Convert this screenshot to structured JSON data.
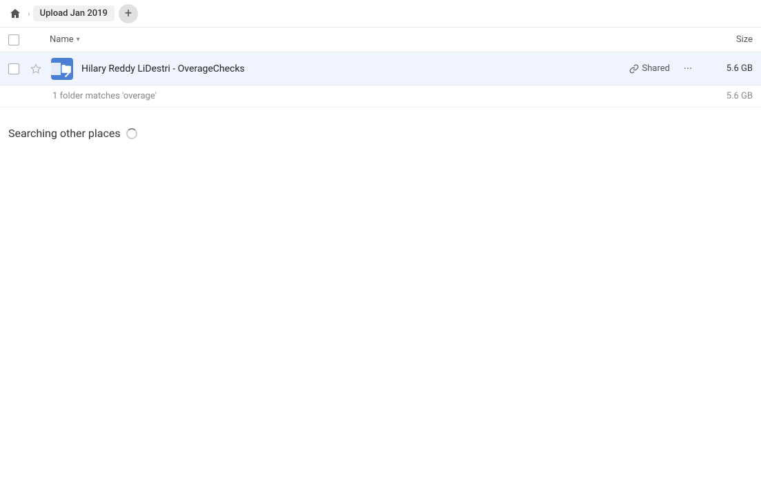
{
  "breadcrumb": {
    "home_label": "Home",
    "title": "Upload Jan 2019",
    "add_label": "+"
  },
  "columns": {
    "name_label": "Name",
    "size_label": "Size"
  },
  "file_row": {
    "name": "Hilary Reddy LiDestri - OverageChecks",
    "shared_label": "Shared",
    "size": "5.6 GB"
  },
  "match_info": {
    "text": "1 folder matches 'overage'",
    "size": "5.6 GB"
  },
  "searching": {
    "label": "Searching other places"
  },
  "icons": {
    "home": "🏠",
    "chevron_right": "›",
    "star": "☆",
    "link": "🔗",
    "more": "···"
  }
}
